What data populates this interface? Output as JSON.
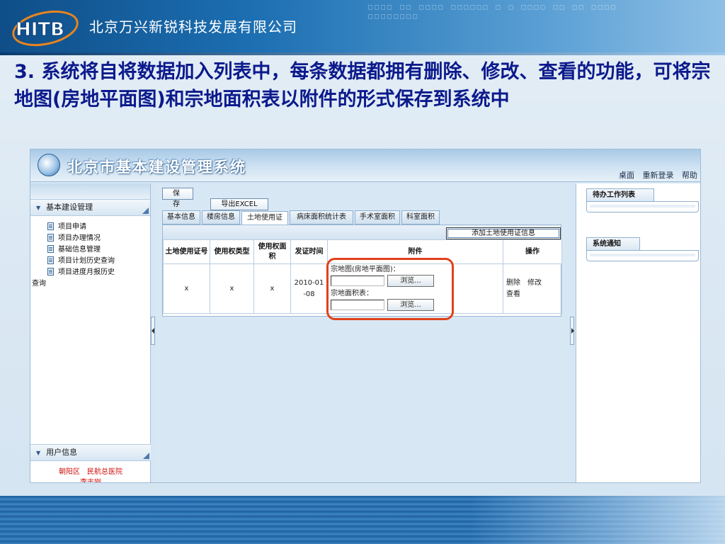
{
  "slide": {
    "company": "北京万兴新锐科技发展有限公司",
    "logo_text": "HITB",
    "title": "3. 系统将自将数据加入列表中，每条数据都拥有删除、修改、查看的功能，可将宗地图(房地平面图)和宗地面积表以附件的形式保存到系统中",
    "band_dots": "□□□□ □□ □□□□ □□□□□□ □ □ □□□□ □□ □□ □□□□ □□□□□□□□"
  },
  "app": {
    "title": "北京市基本建设管理系统",
    "top_links": [
      "桌面",
      "重新登录",
      "帮助"
    ],
    "sidebar": {
      "section1": "基本建设管理",
      "items": [
        "项目申请",
        "项目办理情况",
        "基础信息管理",
        "项目计划历史查询",
        "项目进度月报历史"
      ],
      "item_wrap": "查询",
      "section2": "用户信息",
      "user_line1": "朝阳区　民航总医院",
      "user_line2": "李志刚"
    },
    "toolbar": {
      "save": "保存",
      "export": "导出EXCEL"
    },
    "tabs": [
      "基本信息",
      "楼房信息",
      "土地使用证",
      "病床面积统计表",
      "手术室面积",
      "科室面积"
    ],
    "active_tab": "土地使用证",
    "add_button": "添加土地使用证信息",
    "table": {
      "headers": [
        "土地使用证号",
        "使用权类型",
        "使用权面积",
        "发证时间",
        "附件",
        "操作"
      ],
      "row": {
        "cert_no": "x",
        "right_type": "x",
        "right_area": "x",
        "issue_date": "2010-01-08",
        "attach_label1": "宗地图(房地平面图)：",
        "attach_label2": "宗地面积表：",
        "browse": "浏览...",
        "ops": [
          "删除",
          "修改",
          "查看"
        ]
      }
    },
    "rightbar": {
      "todo": "待办工作列表",
      "notice": "系统通知"
    }
  },
  "colors": {
    "title_text": "#0c1a8c",
    "highlight": "#e0411b",
    "user_text": "#d01010"
  }
}
